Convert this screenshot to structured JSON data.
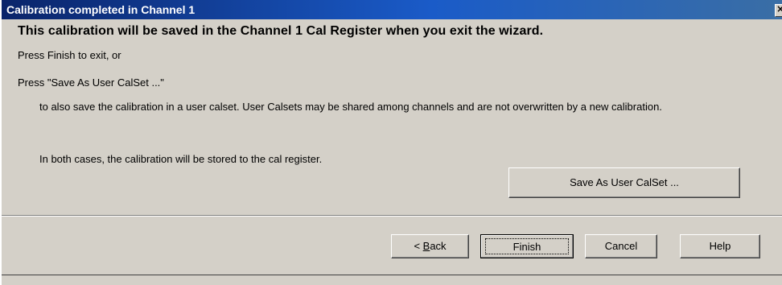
{
  "window": {
    "title": "Calibration completed in Channel 1",
    "close_glyph": "×"
  },
  "body": {
    "heading": "This calibration will be saved in the Channel 1 Cal Register when you exit the wizard.",
    "line_finish": "Press Finish to exit, or",
    "line_saveas": "Press \"Save As User CalSet ...\"",
    "line_explain": "to also save the calibration in a user calset.  User Calsets may be shared among channels and are not overwritten by a new calibration.",
    "line_both": "In both cases, the calibration will be stored to the cal register.",
    "save_calset_label": "Save As User CalSet ..."
  },
  "footer": {
    "back_label_prefix": "< ",
    "back_label_mnemonic": "B",
    "back_label_rest": "ack",
    "finish_label": "Finish",
    "cancel_label": "Cancel",
    "help_label": "Help"
  }
}
